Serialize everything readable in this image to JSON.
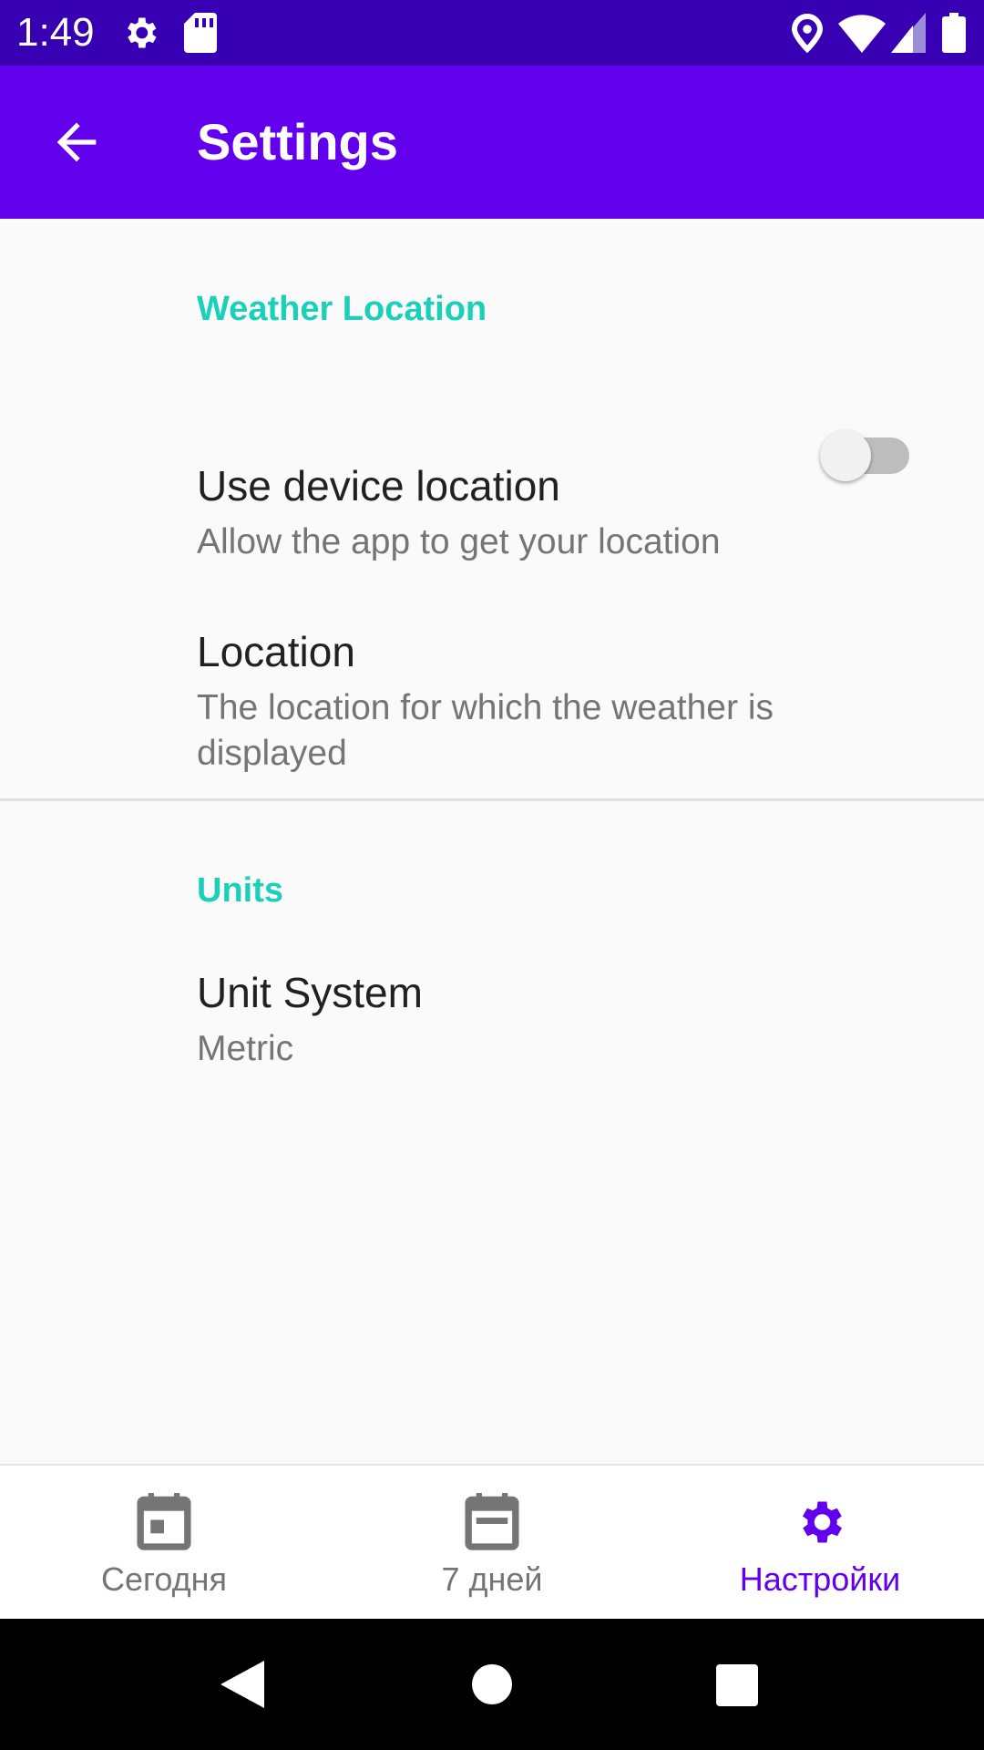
{
  "status_bar": {
    "time": "1:49",
    "icons": [
      "gear-icon",
      "sd-card-icon",
      "location-pin-icon",
      "wifi-icon",
      "signal-icon",
      "battery-icon"
    ]
  },
  "app_bar": {
    "title": "Settings",
    "back_icon": "arrow-back-icon"
  },
  "settings": {
    "weather_category": "Weather Location",
    "device_location": {
      "title": "Use device location",
      "summary": "Allow the app to get your location",
      "enabled": false
    },
    "location": {
      "title": "Location",
      "summary": "The location for which the weather is displayed"
    },
    "units_category": "Units",
    "unit_system": {
      "title": "Unit System",
      "summary": "Metric"
    }
  },
  "bottom_nav": {
    "items": [
      {
        "label": "Сегодня",
        "icon": "calendar-today-icon",
        "active": false
      },
      {
        "label": "7 дней",
        "icon": "calendar-week-icon",
        "active": false
      },
      {
        "label": "Настройки",
        "icon": "settings-gear-icon",
        "active": true
      }
    ]
  },
  "colors": {
    "status_bar": "#3700b3",
    "app_bar": "#6200ee",
    "category_accent": "#1ad1b8",
    "nav_active": "#6200ee",
    "nav_inactive": "#757575"
  },
  "system_nav": {
    "icons": [
      "back-triangle-icon",
      "home-circle-icon",
      "recents-square-icon"
    ]
  }
}
